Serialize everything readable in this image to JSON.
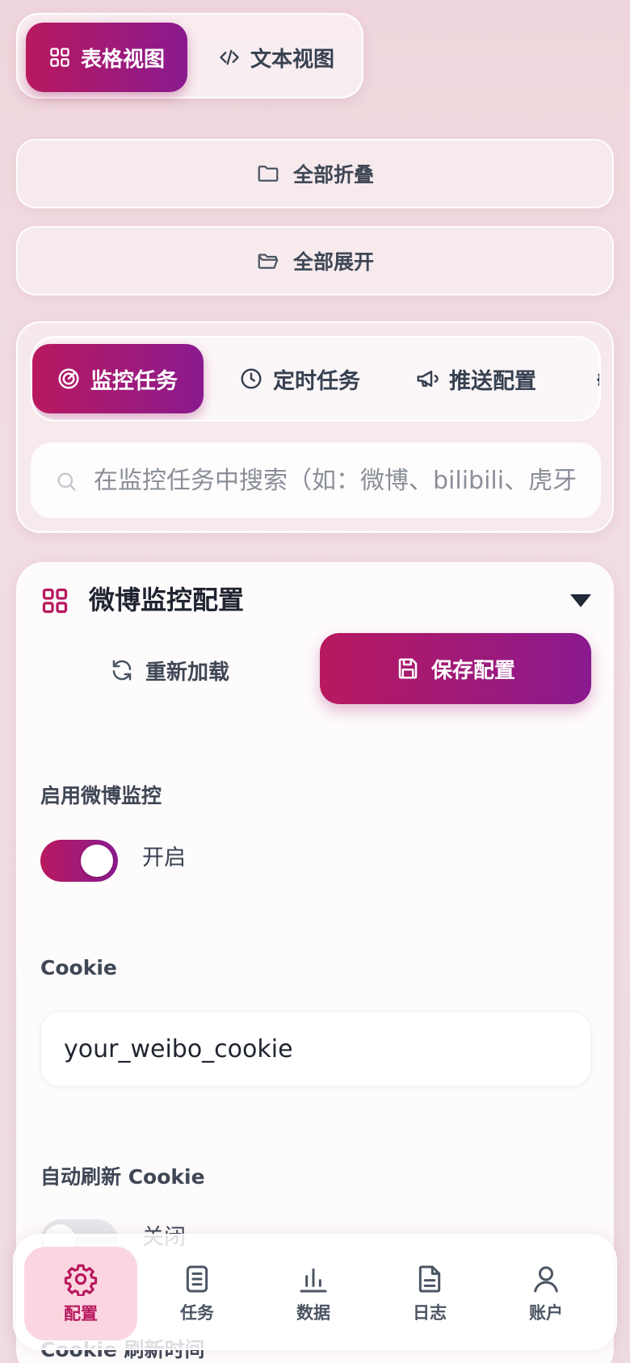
{
  "view_switch": {
    "table_view": "表格视图",
    "text_view": "文本视图"
  },
  "actions": {
    "collapse_all": "全部折叠",
    "expand_all": "全部展开"
  },
  "tabs": [
    {
      "label": "监控任务",
      "icon": "radar-icon",
      "active": true
    },
    {
      "label": "定时任务",
      "icon": "clock-icon",
      "active": false
    },
    {
      "label": "推送配置",
      "icon": "megaphone-icon",
      "active": false
    }
  ],
  "search": {
    "placeholder": "在监控任务中搜索（如：微博、bilibili、虎牙"
  },
  "card": {
    "title": "微博监控配置",
    "reload_label": "重新加载",
    "save_label": "保存配置",
    "fields": {
      "enable_label": "启用微博监控",
      "enable_state": "开启",
      "cookie_label": "Cookie",
      "cookie_value": "your_weibo_cookie",
      "auto_refresh_label": "自动刷新 Cookie",
      "auto_refresh_state": "关闭",
      "refresh_time_label": "Cookie 刷新时间"
    }
  },
  "nav": [
    {
      "label": "配置",
      "icon": "gear-icon",
      "active": true
    },
    {
      "label": "任务",
      "icon": "clipboard-icon",
      "active": false
    },
    {
      "label": "数据",
      "icon": "bar-chart-icon",
      "active": false
    },
    {
      "label": "日志",
      "icon": "document-icon",
      "active": false
    },
    {
      "label": "账户",
      "icon": "user-icon",
      "active": false
    }
  ],
  "colors": {
    "accent_start": "#b8195f",
    "accent_end": "#8a1a8f",
    "nav_active_bg": "#fbd6e0"
  }
}
